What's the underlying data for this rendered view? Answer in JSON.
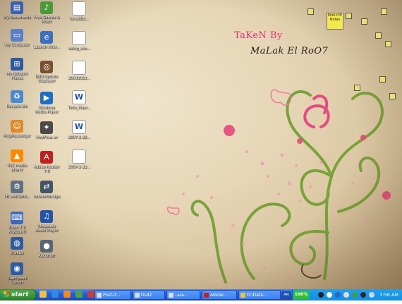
{
  "watermark": {
    "line1": "TaKeN By",
    "line2": "MaLak El RoO7"
  },
  "desktop_icons": [
    {
      "id": "my-documents",
      "label": "My Documents",
      "color": "#3a5fb0"
    },
    {
      "id": "my-computer",
      "label": "My Computer",
      "color": "#5a7ec8"
    },
    {
      "id": "my-network-places",
      "label": "My Network Places",
      "color": "#2d5a9e"
    },
    {
      "id": "recycle-bin",
      "label": "Recycle Bin",
      "color": "#4a8ad0"
    },
    {
      "id": "msn-messenger",
      "label": "MsgMessenger",
      "color": "#e08a2a"
    },
    {
      "id": "vlc",
      "label": "VLC media player",
      "color": "#ff8800"
    },
    {
      "id": "realtek",
      "label": "PE and Setti...",
      "color": "#607080"
    },
    {
      "id": "flash",
      "label": "Flash 7.0 Keyboard",
      "color": "#3c6ab8"
    },
    {
      "id": "internet",
      "label": "Inwebe",
      "color": "#2f5ca0"
    },
    {
      "id": "startpoint",
      "label": "Start point Center",
      "color": "#2f5ca0"
    },
    {
      "id": "free-games",
      "label": "Free Games & Music",
      "color": "#4a9a3a"
    },
    {
      "id": "launch",
      "label": "Launch Inter...",
      "color": "#3b6fc0"
    },
    {
      "id": "dvd-update",
      "label": "DVD Update Displayer",
      "color": "#7a5030"
    },
    {
      "id": "wmp",
      "label": "Windows Media Player",
      "color": "#1d6ec8"
    },
    {
      "id": "freeflow",
      "label": "FreeFlow..er",
      "color": "#4a4a4a"
    },
    {
      "id": "adobe-reader",
      "label": "Adobe Reader 7.0",
      "color": "#c02020"
    },
    {
      "id": "network-bridge",
      "label": "networkbridge",
      "color": "#445566"
    },
    {
      "id": "realplayer",
      "label": "Rhapsody Audio Player",
      "color": "#2255aa"
    },
    {
      "id": "recorder",
      "label": "Recorder",
      "color": "#556677"
    },
    {
      "id": "doc1",
      "label": "lol-wi8bl...",
      "color": "#ffffff"
    },
    {
      "id": "doc2",
      "label": "uaing_uso...",
      "color": "#ffffff"
    },
    {
      "id": "doc3",
      "label": "20031013...",
      "color": "#ffffff"
    },
    {
      "id": "doc4",
      "label": "Todo_Mayr...",
      "color": "#ffffff"
    },
    {
      "id": "doc5",
      "label": "2007-2-22...",
      "color": "#ffffff"
    },
    {
      "id": "doc6",
      "label": "2007-2-22...",
      "color": "#ffffff"
    }
  ],
  "postit": {
    "text": "Post-it® Notes",
    "label": ""
  },
  "taskbar": {
    "start_label": "start",
    "tasks": [
      "Post-it...",
      "Dsd2",
      "هاتف...",
      "Adobe ...",
      "D:\\Data..."
    ],
    "language": "AR",
    "battery": "100%",
    "clock": "3:56 AM"
  }
}
